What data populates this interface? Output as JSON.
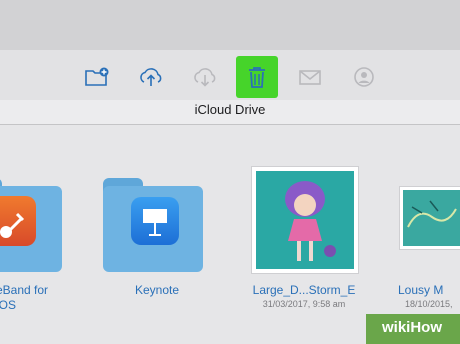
{
  "location": {
    "title": "iCloud Drive"
  },
  "toolbar": {
    "buttons": [
      {
        "name": "new-folder",
        "icon": "folder-plus-icon",
        "enabled": true
      },
      {
        "name": "upload",
        "icon": "cloud-upload-icon",
        "enabled": true
      },
      {
        "name": "download",
        "icon": "cloud-download-icon",
        "enabled": false
      },
      {
        "name": "delete",
        "icon": "trash-icon",
        "enabled": true,
        "highlighted": true
      },
      {
        "name": "share-mail",
        "icon": "envelope-icon",
        "enabled": false
      },
      {
        "name": "add-person",
        "icon": "add-person-icon",
        "enabled": false
      }
    ]
  },
  "files": [
    {
      "label": "eBand for",
      "label2": "iOS",
      "date": "",
      "kind": "folder",
      "icon": "guitar-app-icon"
    },
    {
      "label": "Keynote",
      "label2": "",
      "date": "",
      "kind": "folder",
      "icon": "keynote-app-icon"
    },
    {
      "label": "Large_D...Storm_E",
      "label2": "",
      "date": "31/03/2017, 9:58 am",
      "kind": "image",
      "icon": "doll-photo-thumbnail"
    },
    {
      "label": "Lousy M",
      "label2": "",
      "date": "18/10/2015,",
      "kind": "image",
      "icon": "sketch-thumbnail"
    }
  ],
  "watermark": {
    "text": "wikiHow"
  },
  "colors": {
    "accent": "#2a70b8",
    "highlight": "#46d42a",
    "folder": "#6eb3e2"
  }
}
